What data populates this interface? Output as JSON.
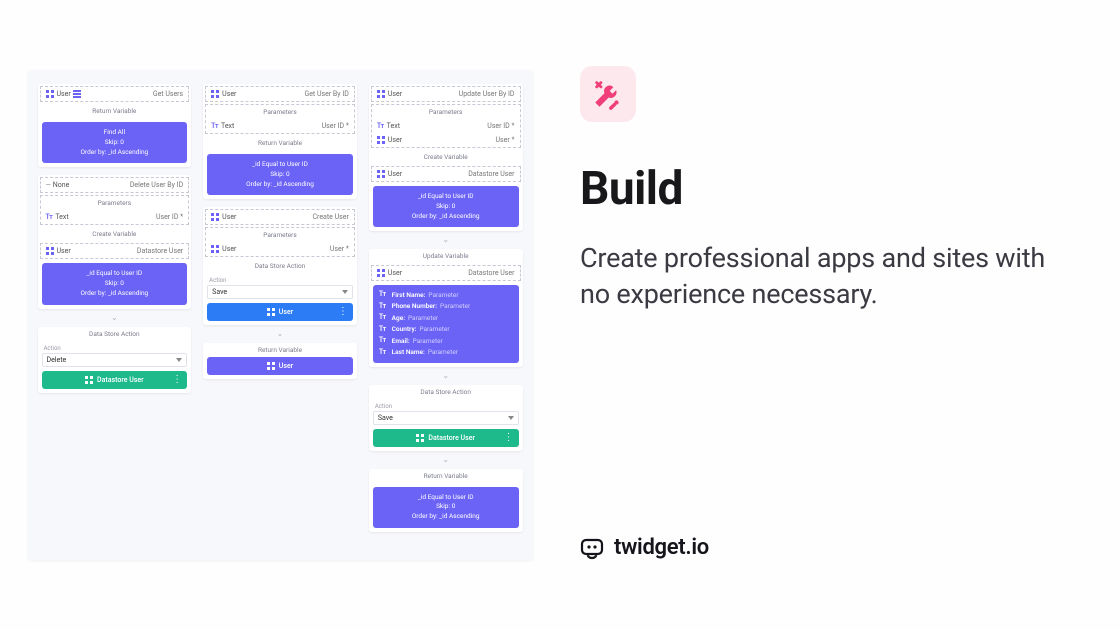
{
  "rhs": {
    "heading": "Build",
    "sub": "Create professional apps and sites with no experience necessary.",
    "brand": "twidget.io"
  },
  "common": {
    "user": "User",
    "text": "Text",
    "none": "None",
    "user_id_req": "User ID *",
    "user_wild": "User *",
    "datastore_user": "Datastore User",
    "parameters": "Parameters",
    "return_variable": "Return Variable",
    "create_variable": "Create Variable",
    "update_variable": "Update Variable",
    "data_store_action": "Data Store Action",
    "action_label": "Action",
    "save": "Save",
    "delete": "Delete",
    "parameter": "Parameter"
  },
  "purple": {
    "id_equal": "_id Equal to User ID",
    "find_all": "Find All",
    "skip": "Skip: 0",
    "order": "Order by: _id Ascending"
  },
  "titles": {
    "get_users": "Get Users",
    "delete_user": "Delete User By ID",
    "get_user": "Get User By ID",
    "create_user": "Create User",
    "update_user": "Update User By ID"
  },
  "fields": {
    "first_name": "First Name:",
    "phone": "Phone Number:",
    "age": "Age:",
    "country": "Country:",
    "email": "Email:",
    "last_name": "Last Name:"
  }
}
